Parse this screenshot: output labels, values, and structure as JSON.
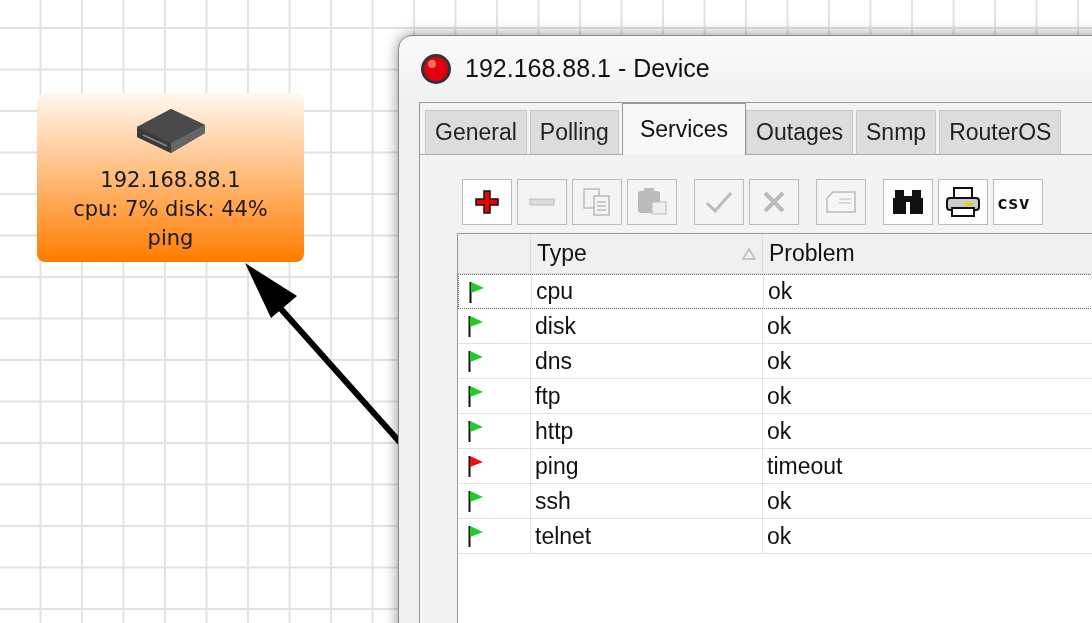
{
  "node": {
    "title": "192.168.88.1",
    "stats": "cpu: 7% disk: 44%",
    "problem": "ping"
  },
  "window": {
    "title": "192.168.88.1 - Device"
  },
  "tabs": [
    {
      "label": "General",
      "selected": false
    },
    {
      "label": "Polling",
      "selected": false
    },
    {
      "label": "Services",
      "selected": true
    },
    {
      "label": "Outages",
      "selected": false
    },
    {
      "label": "Snmp",
      "selected": false
    },
    {
      "label": "RouterOS",
      "selected": false
    }
  ],
  "toolbar": [
    {
      "kind": "add",
      "disabled": false
    },
    {
      "kind": "remove",
      "disabled": true
    },
    {
      "kind": "copy",
      "disabled": true
    },
    {
      "kind": "paste",
      "disabled": true
    },
    {
      "kind": "enable",
      "disabled": true
    },
    {
      "kind": "disable",
      "disabled": true
    },
    {
      "kind": "comment",
      "disabled": true
    },
    {
      "kind": "find",
      "disabled": false
    },
    {
      "kind": "print",
      "disabled": false
    },
    {
      "kind": "csv",
      "label": "csv",
      "disabled": false
    }
  ],
  "table": {
    "columns": [
      {
        "label": "Type",
        "sorted": true
      },
      {
        "label": "Problem",
        "sorted": false
      }
    ],
    "rows": [
      {
        "type": "cpu",
        "problem": "ok",
        "color": "#22cc22",
        "selected": true
      },
      {
        "type": "disk",
        "problem": "ok",
        "color": "#22cc22",
        "selected": false
      },
      {
        "type": "dns",
        "problem": "ok",
        "color": "#22cc22",
        "selected": false
      },
      {
        "type": "ftp",
        "problem": "ok",
        "color": "#22cc22",
        "selected": false
      },
      {
        "type": "http",
        "problem": "ok",
        "color": "#22cc22",
        "selected": false
      },
      {
        "type": "ping",
        "problem": "timeout",
        "color": "#ee1111",
        "selected": false
      },
      {
        "type": "ssh",
        "problem": "ok",
        "color": "#22cc22",
        "selected": false
      },
      {
        "type": "telnet",
        "problem": "ok",
        "color": "#22cc22",
        "selected": false
      }
    ]
  }
}
